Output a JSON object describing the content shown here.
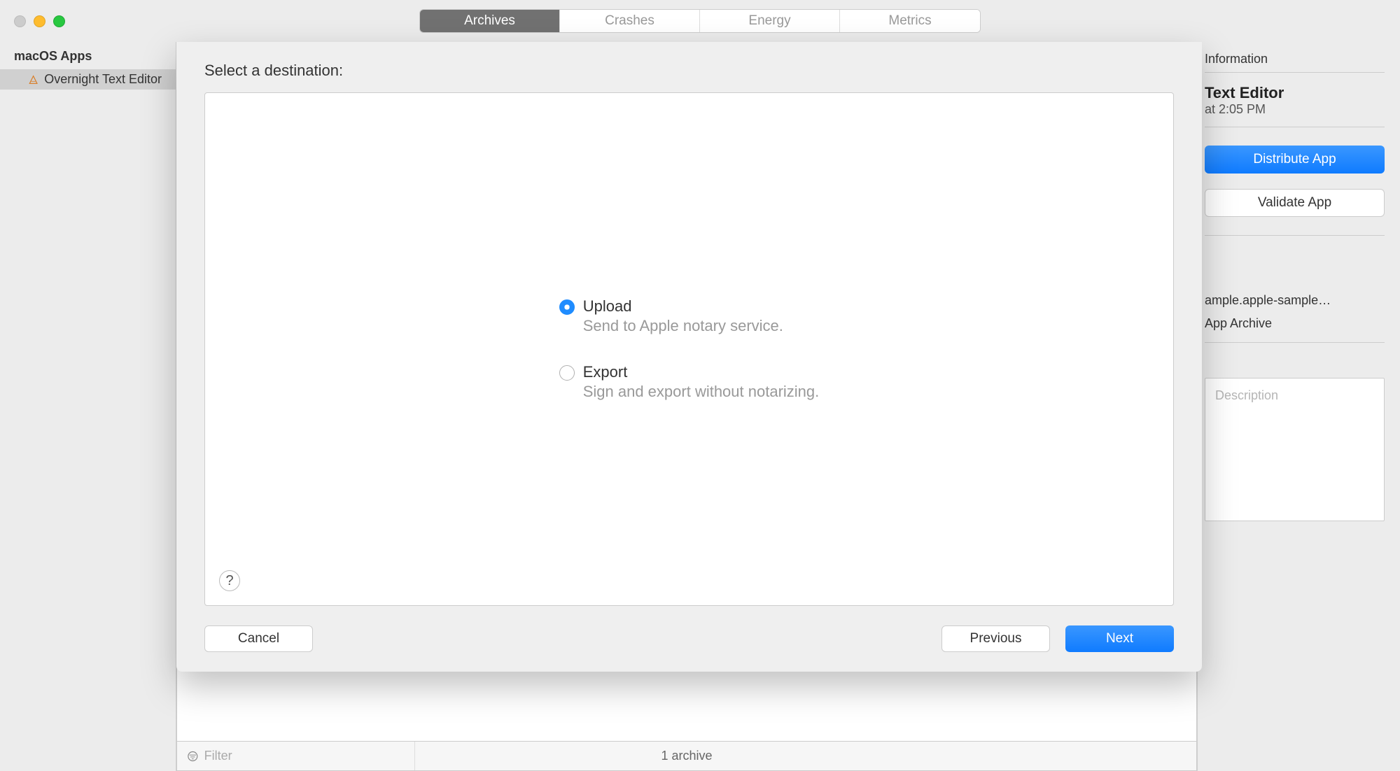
{
  "tabs": [
    "Archives",
    "Crashes",
    "Energy",
    "Metrics"
  ],
  "active_tab": "Archives",
  "sidebar": {
    "header": "macOS Apps",
    "items": [
      {
        "label": "Overnight Text Editor"
      }
    ]
  },
  "right_panel": {
    "section_label": "Information",
    "app_name": "Text Editor",
    "app_date": "at 2:05 PM",
    "distribute_label": "Distribute App",
    "validate_label": "Validate App",
    "bundle_id": "ample.apple-sample…",
    "archive_type": "App Archive",
    "description_placeholder": "Description"
  },
  "footer": {
    "filter_placeholder": "Filter",
    "archive_count": "1 archive"
  },
  "sheet": {
    "title": "Select a destination:",
    "options": [
      {
        "label": "Upload",
        "description": "Send to Apple notary service.",
        "selected": true
      },
      {
        "label": "Export",
        "description": "Sign and export without notarizing.",
        "selected": false
      }
    ],
    "help": "?",
    "cancel": "Cancel",
    "previous": "Previous",
    "next": "Next"
  }
}
